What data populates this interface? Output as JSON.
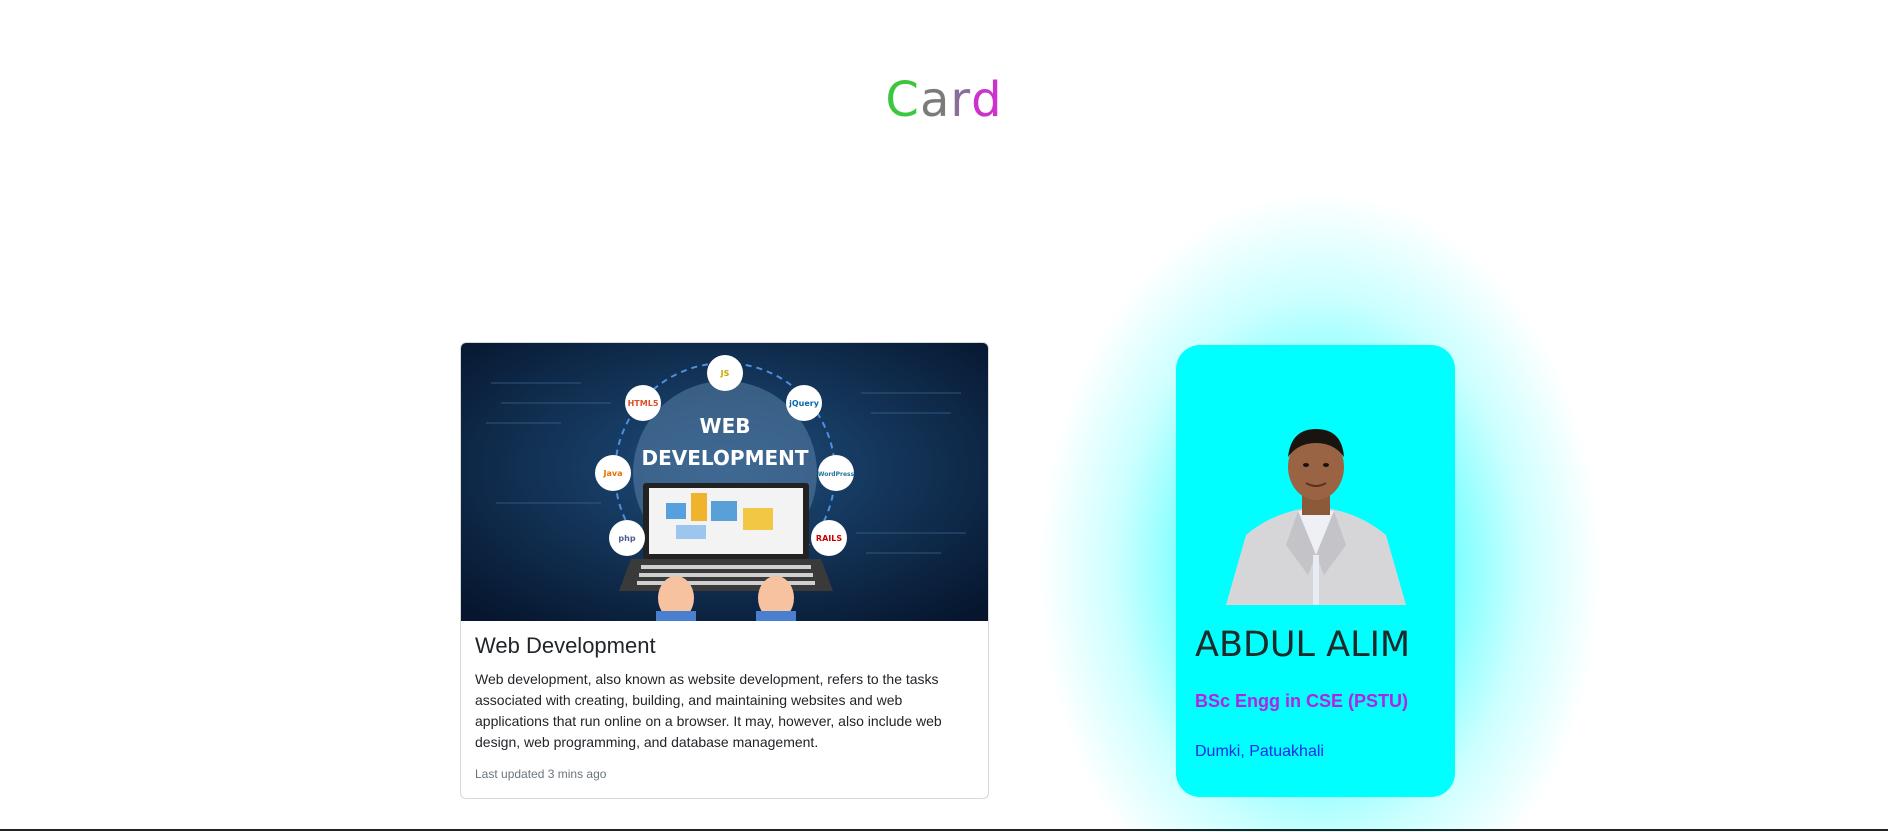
{
  "header": {
    "title_letters": [
      "C",
      "a",
      "r",
      "d"
    ],
    "title_colors": [
      "#3fc63f",
      "#7b7b7b",
      "#8a6e9a",
      "#cc33cc"
    ]
  },
  "web_card": {
    "image_heading_line1": "WEB",
    "image_heading_line2": "DEVELOPMENT",
    "image_icons": [
      "JS",
      "HTML5",
      "jQuery",
      "Java",
      "WordPress",
      "php",
      "RAILS"
    ],
    "title": "Web Development",
    "text": "Web development, also known as website development, refers to the tasks associated with creating, building, and maintaining websites and web applications that run online on a browser. It may, however, also include web design, web programming, and database management.",
    "updated": "Last updated 3 mins ago"
  },
  "profile_card": {
    "name": "ABDUL ALIM",
    "degree": "BSc Engg in CSE (PSTU)",
    "location": "Dumki, Patuakhali",
    "background": "#00ffff"
  }
}
